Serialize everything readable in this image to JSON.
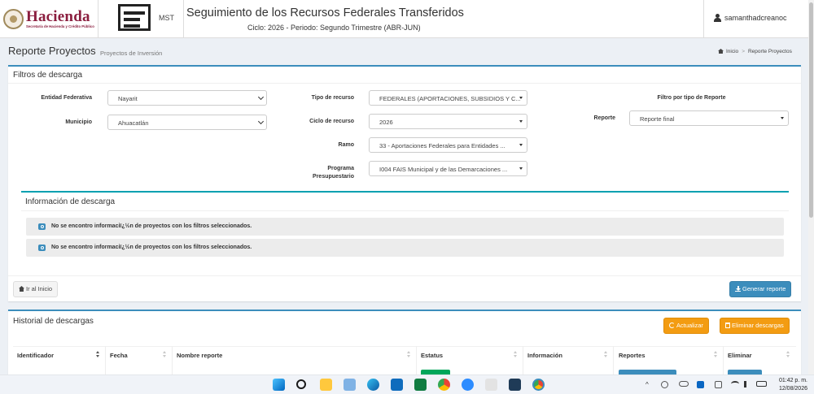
{
  "header": {
    "logo_name": "Hacienda",
    "logo_subtitle": "Secretaría de Hacienda y Crédito Público",
    "mst_label": "MST",
    "system_title": "Seguimiento de los Recursos Federales Transferidos",
    "cycle_period": "Ciclo: 2026 - Periodo: Segundo Trimestre (ABR-JUN)",
    "user_name": "samanthadcreanoc"
  },
  "page": {
    "title": "Reporte Proyectos",
    "subtitle": "Proyectos de Inversión",
    "breadcrumb": [
      "Inicio",
      "Reporte Proyectos"
    ]
  },
  "filters": {
    "panel_title": "Filtros de descarga",
    "entidad_label": "Entidad Federativa",
    "entidad_value": "Nayarit",
    "municipio_label": "Municipio",
    "municipio_value": "Ahuacatlán",
    "tipo_recurso_label": "Tipo de recurso",
    "tipo_recurso_value": "FEDERALES (APORTACIONES, SUBSIDIOS Y C...",
    "ciclo_label": "Ciclo de recurso",
    "ciclo_value": "2026",
    "ramo_label": "Ramo",
    "ramo_value": "33 - Aportaciones Federales para Entidades ...",
    "programa_label": "Programa Presupuestario",
    "programa_value": "I004 FAIS Municipal y de las Demarcaciones ...",
    "filtro_tipo_label": "Filtro por tipo de Reporte",
    "reporte_label": "Reporte",
    "reporte_value": "Reporte final"
  },
  "info": {
    "title": "Información de descarga",
    "alerts": [
      "No se encontro informaciï¿½n de proyectos con los filtros seleccionados.",
      "No se encontro informaciï¿½n de proyectos con los filtros seleccionados."
    ]
  },
  "actions": {
    "home_button": "Ir al Inicio",
    "generate_button": "Generar reporte"
  },
  "history": {
    "title": "Historial de descargas",
    "refresh_button": "Actualizar",
    "delete_button": "Eliminar descargas",
    "columns": [
      "Identificador",
      "Fecha",
      "Nombre reporte",
      "Estatus",
      "Información",
      "Reportes",
      "Eliminar"
    ]
  },
  "taskbar": {
    "time": "01:42 p. m.",
    "date": "12/08/2026",
    "tray_up": "^"
  },
  "colors": {
    "primary": "#3c8dbc",
    "warning": "#f39c12",
    "brand": "#8b1e3f",
    "info_accent": "#00a0b0"
  }
}
